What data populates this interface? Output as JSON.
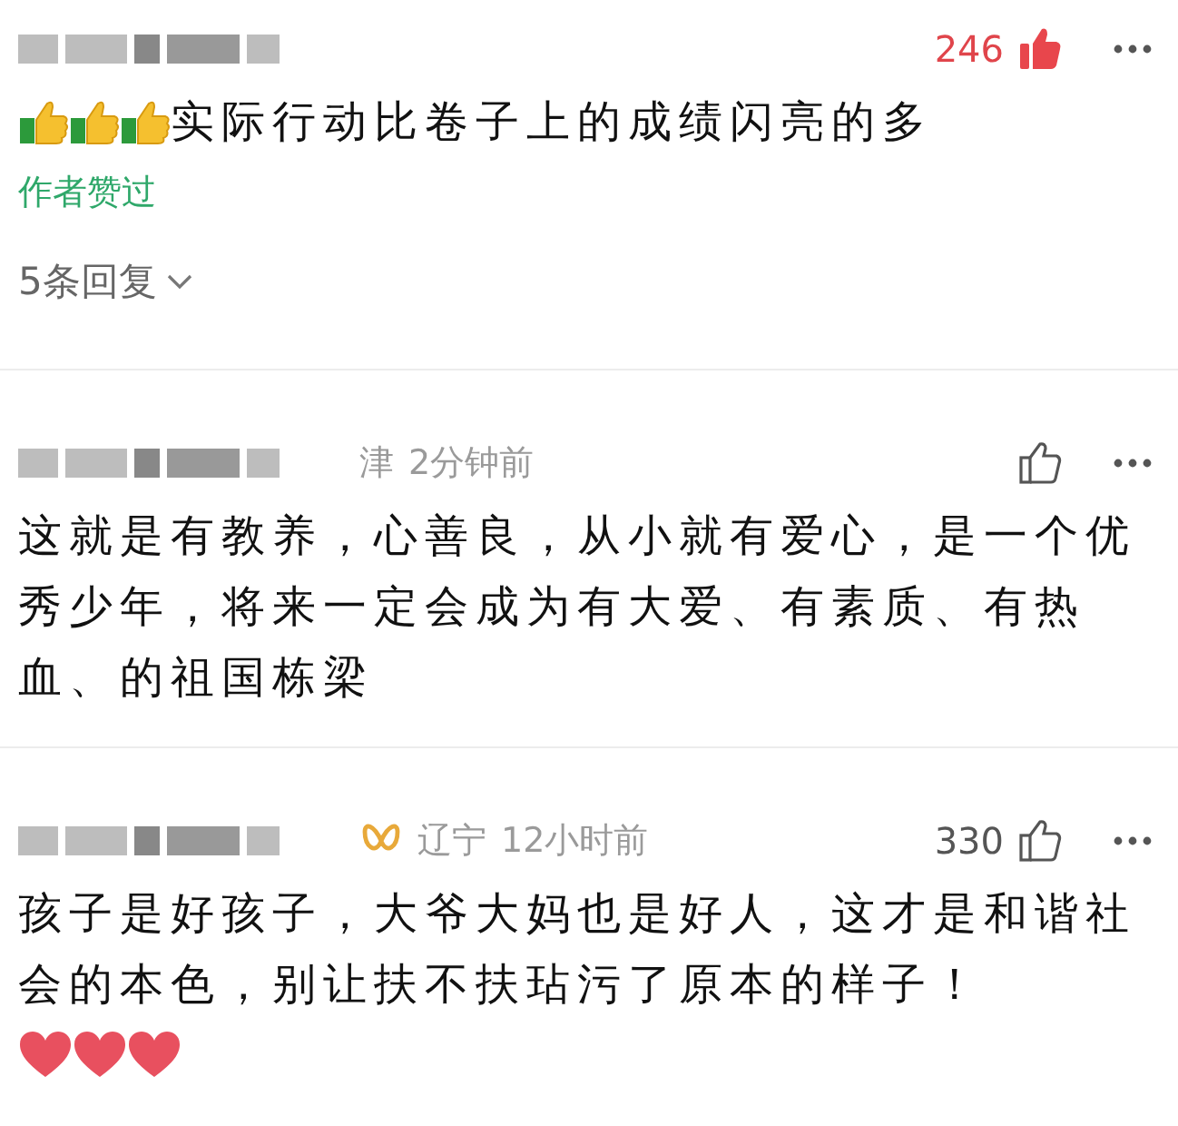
{
  "comments": [
    {
      "like_count": "246",
      "liked": true,
      "parts": [
        {
          "kind": "thumbs-up-emoji"
        },
        {
          "kind": "thumbs-up-emoji"
        },
        {
          "kind": "thumbs-up-emoji"
        },
        {
          "kind": "text",
          "text": "实际行动比卷子上的成绩闪亮的多"
        }
      ],
      "author_liked": "作者赞过",
      "replies": "5条回复"
    },
    {
      "location": "津",
      "time": "2分钟前",
      "liked": false,
      "parts": [
        {
          "kind": "text",
          "text": "这就是有教养，心善良，从小就有爱心，是一个优秀少年，将来一定会成为有大爱、有素质、有热血、的祖国栋梁"
        }
      ]
    },
    {
      "badge": true,
      "location": "辽宁",
      "time": "12小时前",
      "like_count": "330",
      "liked": false,
      "parts": [
        {
          "kind": "text",
          "text": "孩子是好孩子，大爷大妈也是好人，这才是和谐社会的本色，别让扶不扶玷污了原本的样子！"
        },
        {
          "kind": "heart-emoji"
        },
        {
          "kind": "heart-emoji"
        },
        {
          "kind": "heart-emoji"
        }
      ]
    }
  ]
}
